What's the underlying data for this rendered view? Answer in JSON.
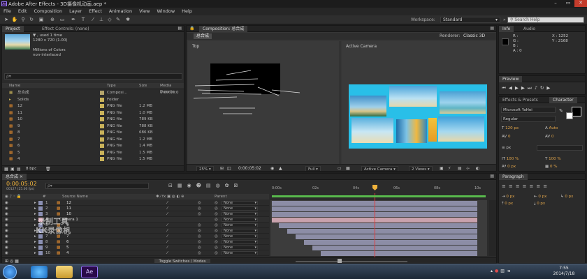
{
  "titlebar": {
    "title": "Adobe After Effects - 3D摄像机动画.aep *"
  },
  "menu": [
    "File",
    "Edit",
    "Composition",
    "Layer",
    "Effect",
    "Animation",
    "View",
    "Window",
    "Help"
  ],
  "workspace": {
    "label": "Workspace:",
    "value": "Standard"
  },
  "search_help": {
    "placeholder": "Search Help"
  },
  "project": {
    "tab": "Project",
    "effect_tab": "Effect Controls: (none)",
    "info_lines": [
      "▼ , used 1 time",
      "1280 x 720 (1.00)",
      "",
      "Millions of Colors",
      "non-interlaced"
    ],
    "search_placeholder": "ρ▾",
    "columns": {
      "name": "Name",
      "type": "Type",
      "size": "Size",
      "duration": "Media Duratio"
    },
    "items": [
      {
        "name": "总合成",
        "type": "Composi...",
        "size": "",
        "duration": "0:00:10:0",
        "color": "#b5a56b",
        "kind": "comp"
      },
      {
        "name": "Solids",
        "type": "Folder",
        "size": "",
        "duration": "",
        "color": "#c9b25a",
        "kind": "folder"
      },
      {
        "name": "12",
        "type": "PNG file",
        "size": "1.2 MB",
        "duration": "",
        "color": "#c9b25a",
        "kind": "png"
      },
      {
        "name": "11",
        "type": "PNG file",
        "size": "1.0 MB",
        "duration": "",
        "color": "#c9b25a",
        "kind": "png"
      },
      {
        "name": "10",
        "type": "PNG file",
        "size": "789 KB",
        "duration": "",
        "color": "#c9b25a",
        "kind": "png"
      },
      {
        "name": "9",
        "type": "PNG file",
        "size": "788 KB",
        "duration": "",
        "color": "#c9b25a",
        "kind": "png"
      },
      {
        "name": "8",
        "type": "PNG file",
        "size": "686 KB",
        "duration": "",
        "color": "#c9b25a",
        "kind": "png"
      },
      {
        "name": "7",
        "type": "PNG file",
        "size": "1.2 MB",
        "duration": "",
        "color": "#c9b25a",
        "kind": "png"
      },
      {
        "name": "6",
        "type": "PNG file",
        "size": "1.4 MB",
        "duration": "",
        "color": "#c9b25a",
        "kind": "png"
      },
      {
        "name": "5",
        "type": "PNG file",
        "size": "1.5 MB",
        "duration": "",
        "color": "#c9b25a",
        "kind": "png"
      },
      {
        "name": "4",
        "type": "PNG file",
        "size": "1.5 MB",
        "duration": "",
        "color": "#c9b25a",
        "kind": "png"
      }
    ],
    "bpc": "8 bpc"
  },
  "composition": {
    "tab": "Composition: 总合成",
    "comp_chip": "总合成",
    "renderer_label": "Renderer:",
    "renderer_value": "Classic 3D",
    "view_left": "Top",
    "view_right": "Active Camera",
    "zoom": "25%",
    "timecode": "0:00:05:02",
    "resolution": "Full",
    "camera": "Active Camera",
    "views": "2 Views"
  },
  "info_panel": {
    "tab": "Info",
    "audio_tab": "Audio",
    "r": "R :",
    "g": "G :",
    "b": "B :",
    "a": "A : 0",
    "x": "X : 1252",
    "y": "Y : 2168"
  },
  "preview": {
    "tab": "Preview"
  },
  "effects": {
    "tab": "Effects & Presets",
    "char_tab": "Character"
  },
  "character": {
    "font": "Microsoft YaHei",
    "style": "Regular",
    "size": "120 px",
    "leading": "Auto",
    "kerning": "0",
    "tracking": "0",
    "stroke": "px",
    "vscale": "100 %",
    "hscale": "100 %",
    "baseline": "0 px",
    "tsume": "0 %"
  },
  "paragraph": {
    "tab": "Paragraph",
    "indent_left": "0 px",
    "indent_right": "0 px",
    "indent_first": "0 px",
    "space_before": "0 px",
    "space_after": "0 px"
  },
  "timeline": {
    "tab": "总合成",
    "timecode": "0:00:05:02",
    "fps": "00127 (25.00 fps)",
    "search_placeholder": "ρ▾",
    "col_source": "Source Name",
    "col_parent": "Parent",
    "ruler": [
      "0:00s",
      "02s",
      "04s",
      "06s",
      "08s",
      "10s"
    ],
    "layers": [
      {
        "num": "1",
        "name": "12",
        "parent": "None",
        "kind": "png"
      },
      {
        "num": "2",
        "name": "11",
        "parent": "None",
        "kind": "png"
      },
      {
        "num": "3",
        "name": "10",
        "parent": "None",
        "kind": "png"
      },
      {
        "num": "4",
        "name": "Camera 1",
        "parent": "None",
        "kind": "camera"
      },
      {
        "num": "5",
        "name": "9",
        "parent": "None",
        "kind": "png"
      },
      {
        "num": "6",
        "name": "8",
        "parent": "None",
        "kind": "png"
      },
      {
        "num": "7",
        "name": "7",
        "parent": "None",
        "kind": "png"
      },
      {
        "num": "8",
        "name": "6",
        "parent": "None",
        "kind": "png"
      },
      {
        "num": "9",
        "name": "5",
        "parent": "None",
        "kind": "png"
      },
      {
        "num": "10",
        "name": "4",
        "parent": "None",
        "kind": "png"
      }
    ],
    "toggle": "Toggle Switches / Modes",
    "watermark1": "录制工具",
    "watermark2": "KK录像机"
  },
  "taskbar": {
    "time": "7:55",
    "date": "2014/7/18",
    "ae_label": "Ae"
  }
}
